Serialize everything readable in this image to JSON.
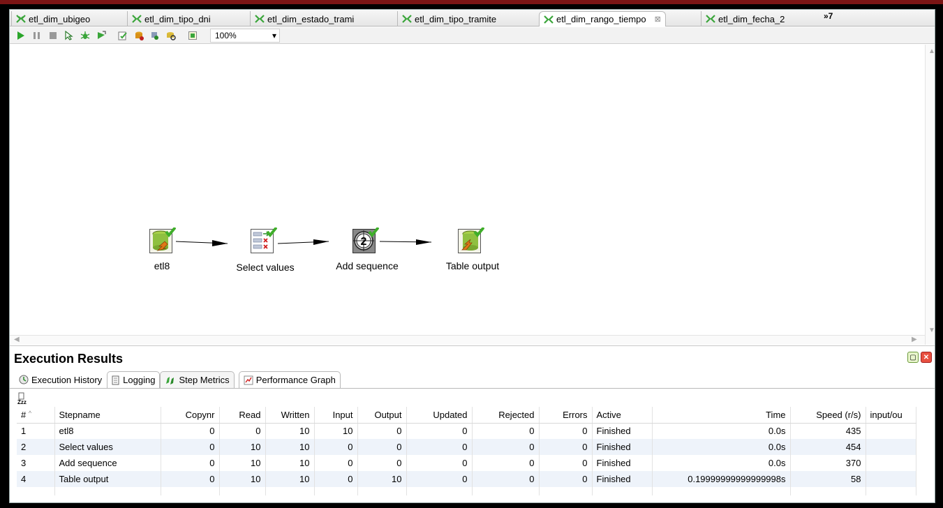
{
  "tabs": [
    {
      "label": "etl_dim_ubigeo",
      "active": false
    },
    {
      "label": "etl_dim_tipo_dni",
      "active": false
    },
    {
      "label": "etl_dim_estado_trami",
      "active": false
    },
    {
      "label": "etl_dim_tipo_tramite",
      "active": false
    },
    {
      "label": "etl_dim_rango_tiempo",
      "active": true
    },
    {
      "label": "etl_dim_fecha_2",
      "active": false
    }
  ],
  "tab_close_symbol": "⊠",
  "tab_overflow": "»7",
  "toolbar": {
    "icons": [
      "run-icon",
      "pause-icon",
      "stop-icon",
      "preview-icon",
      "debug-icon",
      "replay-icon",
      "verify-icon",
      "impact-icon",
      "sql-icon",
      "explore-db-icon",
      "grid-icon"
    ],
    "zoom": "100%"
  },
  "canvas": {
    "steps": [
      {
        "name": "etl8"
      },
      {
        "name": "Select values"
      },
      {
        "name": "Add sequence"
      },
      {
        "name": "Table output"
      }
    ]
  },
  "exec": {
    "title": "Execution Results",
    "tabs": [
      {
        "label": "Execution History",
        "icon": "history-icon"
      },
      {
        "label": "Logging",
        "icon": "logging-icon"
      },
      {
        "label": "Step Metrics",
        "icon": "step-metrics-icon"
      },
      {
        "label": "Performance Graph",
        "icon": "performance-graph-icon"
      }
    ],
    "columns": [
      "#",
      "Stepname",
      "Copynr",
      "Read",
      "Written",
      "Input",
      "Output",
      "Updated",
      "Rejected",
      "Errors",
      "Active",
      "Time",
      "Speed (r/s)",
      "input/ou"
    ],
    "rows": [
      [
        "1",
        "etl8",
        "0",
        "0",
        "10",
        "10",
        "0",
        "0",
        "0",
        "0",
        "Finished",
        "0.0s",
        "435",
        ""
      ],
      [
        "2",
        "Select values",
        "0",
        "10",
        "10",
        "0",
        "0",
        "0",
        "0",
        "0",
        "Finished",
        "0.0s",
        "454",
        ""
      ],
      [
        "3",
        "Add sequence",
        "0",
        "10",
        "10",
        "0",
        "0",
        "0",
        "0",
        "0",
        "Finished",
        "0.0s",
        "370",
        ""
      ],
      [
        "4",
        "Table output",
        "0",
        "10",
        "10",
        "0",
        "10",
        "0",
        "0",
        "0",
        "Finished",
        "0.19999999999999998s",
        "58",
        ""
      ]
    ]
  },
  "colors": {
    "accent_green": "#3fae2a",
    "row_alt": "#eef3fa",
    "frame": "#000000"
  }
}
